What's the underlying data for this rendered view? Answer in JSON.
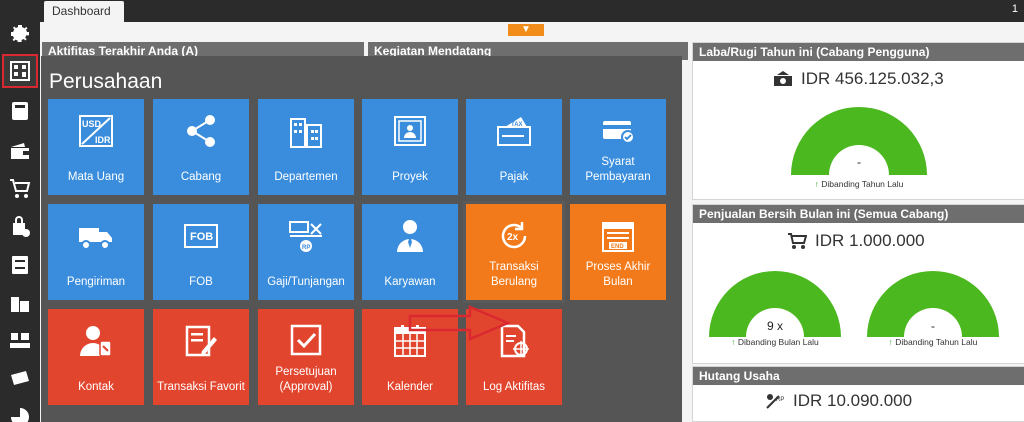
{
  "topbar": {
    "tab_label": "Dashboard",
    "right_number": "1"
  },
  "dashboard": {
    "panel_left_title": "Aktifitas Terakhir Anda (A)",
    "panel_mid_title": "Kegiatan Mendatang",
    "profit": {
      "title": "Laba/Rugi Tahun ini (Cabang Pengguna)",
      "amount": "IDR 456.125.032,3",
      "gauge_value": "-",
      "note": "Dibanding Tahun Lalu"
    },
    "sales": {
      "title": "Penjualan Bersih Bulan ini (Semua Cabang)",
      "amount": "IDR 1.000.000",
      "gauge1_value": "9 x",
      "gauge1_note": "Dibanding Bulan Lalu",
      "gauge2_value": "-",
      "gauge2_note": "Dibanding Tahun Lalu"
    },
    "debt": {
      "title": "Hutang Usaha",
      "amount": "IDR 10.090.000"
    }
  },
  "menu": {
    "title": "Perusahaan",
    "tiles": [
      {
        "label": "Mata Uang",
        "icon": "currency-icon"
      },
      {
        "label": "Cabang",
        "icon": "branch-icon"
      },
      {
        "label": "Departemen",
        "icon": "building-icon"
      },
      {
        "label": "Proyek",
        "icon": "project-icon"
      },
      {
        "label": "Pajak",
        "icon": "tax-icon"
      },
      {
        "label": "Syarat Pembayaran",
        "icon": "card-check-icon"
      },
      {
        "label": "Pengiriman",
        "icon": "truck-icon"
      },
      {
        "label": "FOB",
        "icon": "fob-icon"
      },
      {
        "label": "Gaji/Tunjangan",
        "icon": "salary-icon"
      },
      {
        "label": "Karyawan",
        "icon": "employee-icon"
      },
      {
        "label": "Transaksi Berulang",
        "icon": "recurring-2x-icon"
      },
      {
        "label": "Proses Akhir Bulan",
        "icon": "calendar-end-icon"
      },
      {
        "label": "Kontak",
        "icon": "contact-icon"
      },
      {
        "label": "Transaksi Favorit",
        "icon": "favorite-edit-icon"
      },
      {
        "label": "Persetujuan (Approval)",
        "icon": "approval-icon"
      },
      {
        "label": "Kalender",
        "icon": "calendar-icon"
      },
      {
        "label": "Log Aktifitas",
        "icon": "log-icon"
      }
    ]
  },
  "colors": {
    "blue": "#3a8ddc",
    "red": "#e2452e",
    "orange": "#f27a1a",
    "gauge_green": "#4cb81f"
  }
}
